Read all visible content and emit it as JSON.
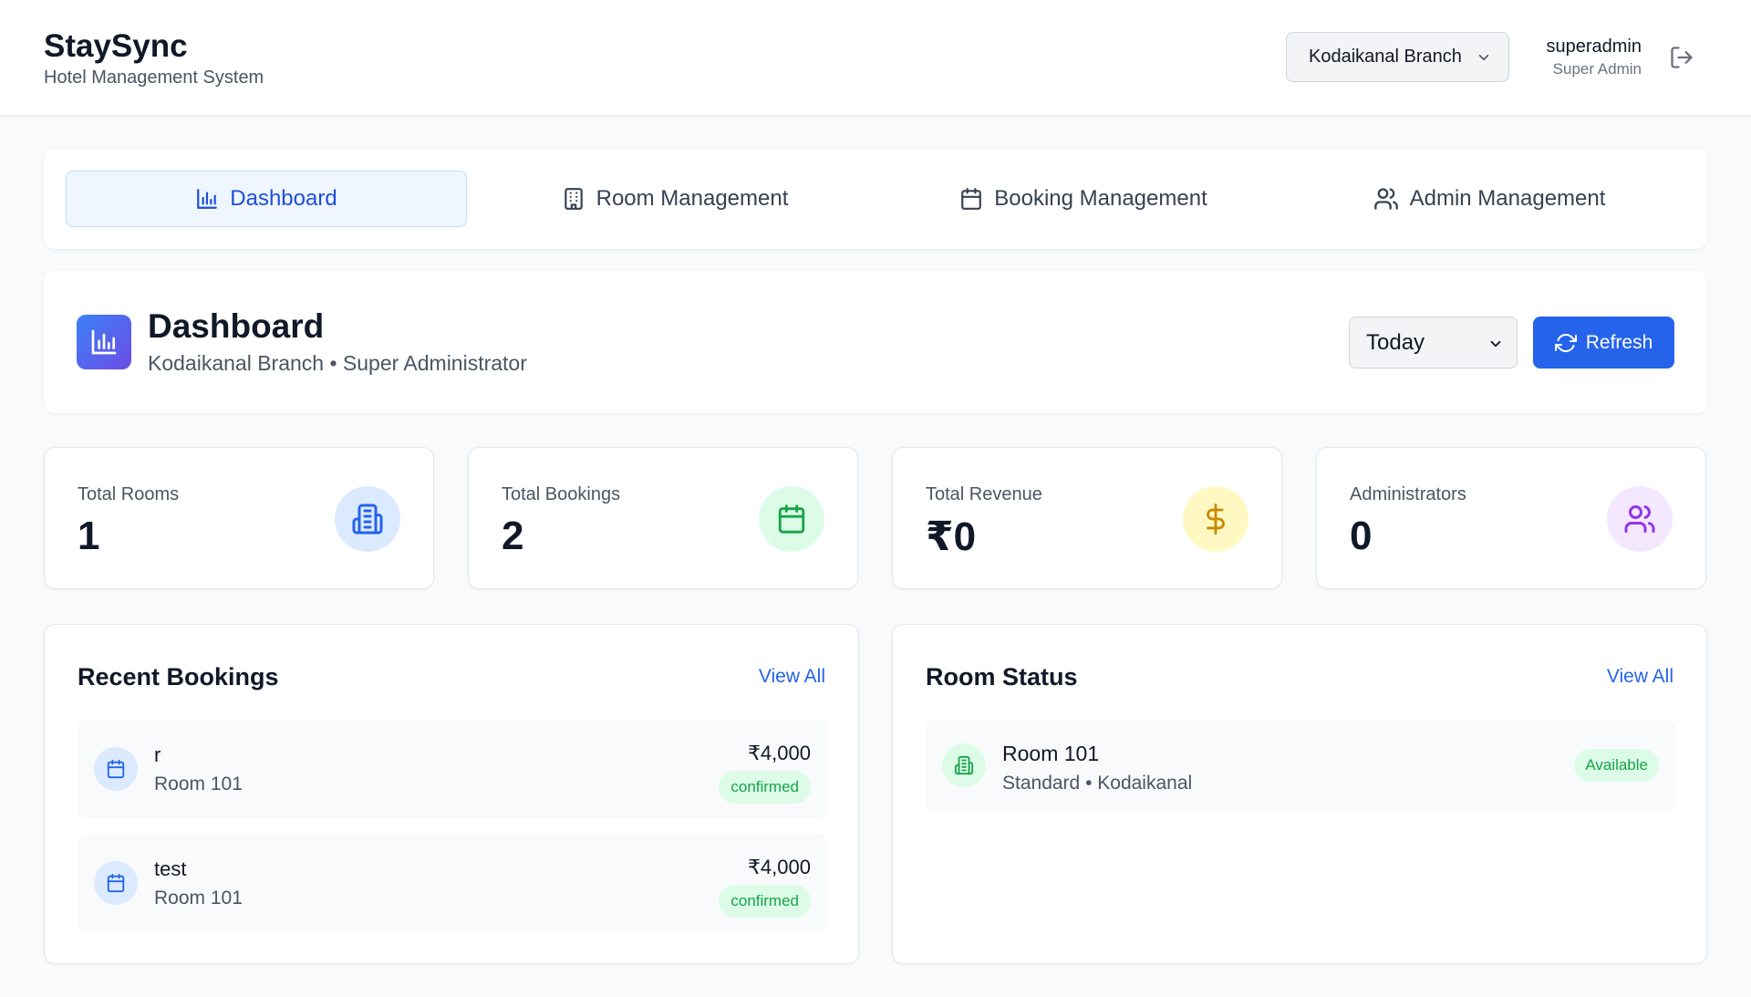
{
  "header": {
    "app_name": "StaySync",
    "app_subtitle": "Hotel Management System",
    "branch_selected": "Kodaikanal Branch",
    "user_name": "superadmin",
    "user_role": "Super Admin"
  },
  "tabs": [
    {
      "label": "Dashboard",
      "icon": "bar-chart-icon",
      "active": true
    },
    {
      "label": "Room Management",
      "icon": "building-icon",
      "active": false
    },
    {
      "label": "Booking Management",
      "icon": "calendar-icon",
      "active": false
    },
    {
      "label": "Admin Management",
      "icon": "users-icon",
      "active": false
    }
  ],
  "dashboard": {
    "title": "Dashboard",
    "subtitle": "Kodaikanal Branch • Super Administrator",
    "period_selected": "Today",
    "refresh_label": "Refresh"
  },
  "stats": [
    {
      "label": "Total Rooms",
      "value": "1",
      "icon": "building-icon",
      "color": "#2563eb",
      "bg": "#dbeafe"
    },
    {
      "label": "Total Bookings",
      "value": "2",
      "icon": "calendar-icon",
      "color": "#16a34a",
      "bg": "#dcfce7"
    },
    {
      "label": "Total Revenue",
      "value": "₹0",
      "icon": "dollar-icon",
      "color": "#ca8a04",
      "bg": "#fef9c3"
    },
    {
      "label": "Administrators",
      "value": "0",
      "icon": "users-icon",
      "color": "#9333ea",
      "bg": "#f3e8ff"
    }
  ],
  "recent_bookings": {
    "title": "Recent Bookings",
    "view_all": "View All",
    "items": [
      {
        "name": "r",
        "room": "Room 101",
        "amount": "₹4,000",
        "status": "confirmed"
      },
      {
        "name": "test",
        "room": "Room 101",
        "amount": "₹4,000",
        "status": "confirmed"
      }
    ]
  },
  "room_status": {
    "title": "Room Status",
    "view_all": "View All",
    "items": [
      {
        "name": "Room 101",
        "details": "Standard • Kodaikanal",
        "status": "Available"
      }
    ]
  }
}
